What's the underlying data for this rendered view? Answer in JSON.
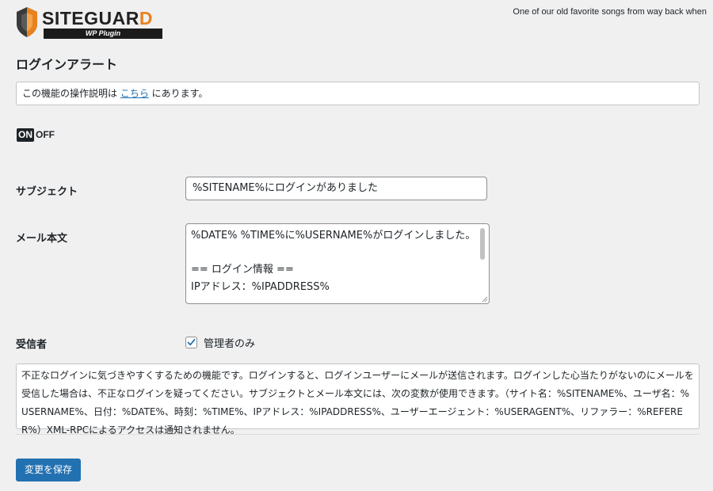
{
  "header": {
    "logo_text_main": "SITEGUAR",
    "logo_text_accent": "D",
    "logo_subtext": "WP Plugin",
    "top_quote": "One of our old favorite songs from way back when"
  },
  "page": {
    "title": "ログインアラート"
  },
  "help": {
    "text_before": "この機能の操作説明は ",
    "link_text": "こちら",
    "text_after": " にあります。"
  },
  "toggle": {
    "on_label": "ON",
    "off_label": "OFF",
    "state": "on"
  },
  "form": {
    "subject_label": "サブジェクト",
    "subject_value": "%SITENAME%にログインがありました",
    "body_label": "メール本文",
    "body_value": "%DATE% %TIME%に%USERNAME%がログインしました。\n\n== ログイン情報 ==\nIPアドレス：%IPADDRESS%",
    "recipient_label": "受信者",
    "recipient_option_label": "管理者のみ",
    "recipient_checked": true
  },
  "description": {
    "text": "不正なログインに気づきやすくするための機能です。ログインすると、ログインユーザーにメールが送信されます。ログインした心当たりがないのにメールを受信した場合は、不正なログインを疑ってください。サブジェクトとメール本文には、次の変数が使用できます。（サイト名：%SITENAME%、ユーザ名：%USERNAME%、日付：%DATE%、時刻：%TIME%、IPアドレス：%IPADDRESS%、ユーザーエージェント：%USERAGENT%、リファラー：%REFERER%）XML-RPCによるアクセスは通知されません。"
  },
  "actions": {
    "save_label": "変更を保存"
  },
  "colors": {
    "accent": "#2271b1",
    "logo_accent": "#e8821e"
  }
}
